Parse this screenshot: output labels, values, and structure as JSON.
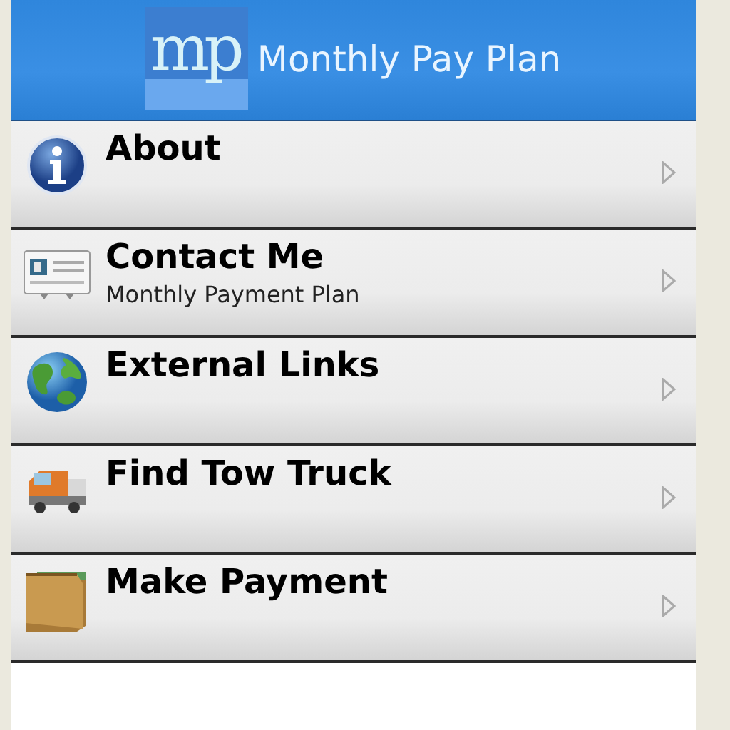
{
  "header": {
    "logo_text": "mp",
    "title": "Monthly Pay Plan"
  },
  "menu": [
    {
      "kind": "info",
      "label": "About"
    },
    {
      "kind": "contact",
      "label": "Contact Me",
      "subtitle": "Monthly Payment Plan"
    },
    {
      "kind": "globe",
      "label": "External Links"
    },
    {
      "kind": "truck",
      "label": "Find Tow Truck"
    },
    {
      "kind": "wallet",
      "label": "Make Payment"
    }
  ]
}
